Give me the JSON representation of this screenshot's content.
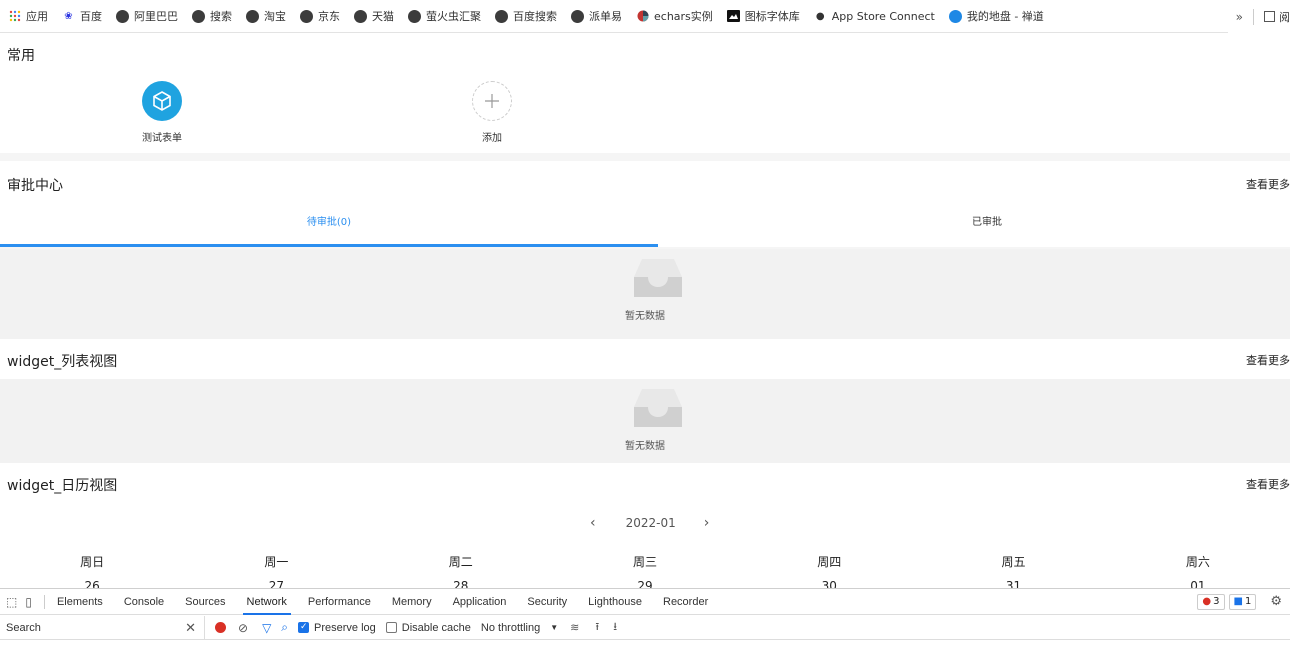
{
  "bookmarks": [
    {
      "icon": "apps-grid-icon",
      "label": "应用"
    },
    {
      "icon": "baidu-paw-icon",
      "label": "百度"
    },
    {
      "icon": "globe-icon",
      "label": "阿里巴巴"
    },
    {
      "icon": "globe-icon",
      "label": "搜索"
    },
    {
      "icon": "globe-icon",
      "label": "淘宝"
    },
    {
      "icon": "globe-icon",
      "label": "京东"
    },
    {
      "icon": "globe-icon",
      "label": "天猫"
    },
    {
      "icon": "globe-icon",
      "label": "萤火虫汇聚"
    },
    {
      "icon": "globe-icon",
      "label": "百度搜索"
    },
    {
      "icon": "globe-icon",
      "label": "派单易"
    },
    {
      "icon": "echarts-icon",
      "label": "echars实例"
    },
    {
      "icon": "iconfont-icon",
      "label": "图标字体库"
    },
    {
      "icon": "apple-icon",
      "label": "App Store Connect"
    },
    {
      "icon": "disk-icon",
      "label": "我的地盘 - 禅道"
    }
  ],
  "bookmarks_more": "»",
  "reader_label": "阅",
  "quick": {
    "title": "常用",
    "items": [
      {
        "label": "测试表单"
      },
      {
        "label": "添加"
      }
    ]
  },
  "approval": {
    "title": "审批中心",
    "see_more": "查看更多",
    "tabs": [
      {
        "label": "待审批(0)",
        "active": true
      },
      {
        "label": "已审批",
        "active": false
      }
    ],
    "empty_text": "暂无数据"
  },
  "list_widget": {
    "title": "widget_列表视图",
    "see_more": "查看更多",
    "empty_text": "暂无数据"
  },
  "calendar_widget": {
    "title": "widget_日历视图",
    "see_more": "查看更多",
    "month": "2022-01",
    "prev": "‹",
    "next": "›",
    "weekdays": [
      "周日",
      "周一",
      "周二",
      "周三",
      "周四",
      "周五",
      "周六"
    ],
    "first_row": [
      "26",
      "27",
      "28",
      "29",
      "30",
      "31",
      "01"
    ]
  },
  "devtools": {
    "tabs": [
      "Elements",
      "Console",
      "Sources",
      "Network",
      "Performance",
      "Memory",
      "Application",
      "Security",
      "Lighthouse",
      "Recorder"
    ],
    "active_tab": "Network",
    "errors": "3",
    "messages": "1",
    "search_label": "Search",
    "preserve_log": "Preserve log",
    "disable_cache": "Disable cache",
    "throttling": "No throttling"
  },
  "colors": {
    "accent": "#2b8ff0",
    "app_icon": "#1fa3e0"
  }
}
